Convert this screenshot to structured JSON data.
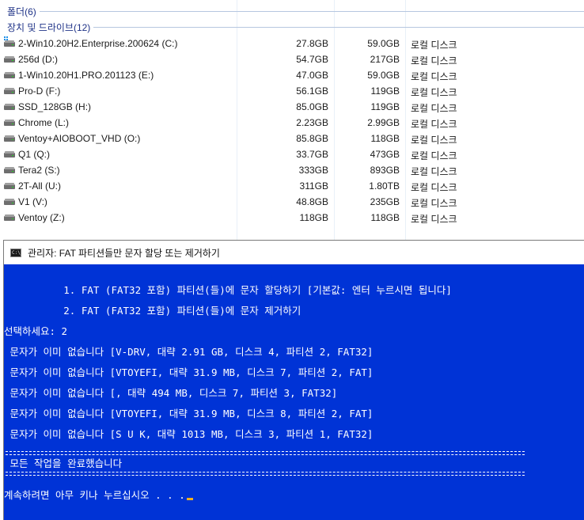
{
  "explorer": {
    "groups": {
      "folders": "폴더(6)",
      "devices": "장치 및 드라이브(12)"
    },
    "drives": [
      {
        "name": "2-Win10.20H2.Enterprise.200624 (C:)",
        "free": "27.8GB",
        "total": "59.0GB",
        "type": "로컬 디스크",
        "icon": "windows-drive-icon"
      },
      {
        "name": "256d (D:)",
        "free": "54.7GB",
        "total": "217GB",
        "type": "로컬 디스크",
        "icon": "drive-icon"
      },
      {
        "name": "1-Win10.20H1.PRO.201123 (E:)",
        "free": "47.0GB",
        "total": "59.0GB",
        "type": "로컬 디스크",
        "icon": "drive-icon"
      },
      {
        "name": "Pro-D (F:)",
        "free": "56.1GB",
        "total": "119GB",
        "type": "로컬 디스크",
        "icon": "drive-icon"
      },
      {
        "name": "SSD_128GB (H:)",
        "free": "85.0GB",
        "total": "119GB",
        "type": "로컬 디스크",
        "icon": "drive-icon"
      },
      {
        "name": "Chrome (L:)",
        "free": "2.23GB",
        "total": "2.99GB",
        "type": "로컬 디스크",
        "icon": "drive-icon"
      },
      {
        "name": "Ventoy+AIOBOOT_VHD (O:)",
        "free": "85.8GB",
        "total": "118GB",
        "type": "로컬 디스크",
        "icon": "drive-icon"
      },
      {
        "name": "Q1 (Q:)",
        "free": "33.7GB",
        "total": "473GB",
        "type": "로컬 디스크",
        "icon": "drive-icon"
      },
      {
        "name": "Tera2 (S:)",
        "free": "333GB",
        "total": "893GB",
        "type": "로컬 디스크",
        "icon": "drive-icon"
      },
      {
        "name": "2T-All (U:)",
        "free": "311GB",
        "total": "1.80TB",
        "type": "로컬 디스크",
        "icon": "drive-icon"
      },
      {
        "name": "V1 (V:)",
        "free": "48.8GB",
        "total": "235GB",
        "type": "로컬 디스크",
        "icon": "drive-icon"
      },
      {
        "name": "Ventoy (Z:)",
        "free": "118GB",
        "total": "118GB",
        "type": "로컬 디스크",
        "icon": "drive-icon"
      }
    ]
  },
  "console": {
    "title": "관리자:  FAT 파티션들만 문자 할당 또는 제거하기",
    "colors": {
      "background": "#0033d6",
      "text": "#ffffff",
      "cursor": "#f0b020"
    },
    "menu": [
      "          1. FAT (FAT32 포함) 파티션(들)에 문자 할당하기 [기본값: 엔터 누르시면 됩니다]",
      "          2. FAT (FAT32 포함) 파티션(들)에 문자 제거하기"
    ],
    "prompt": "선택하세요: 2",
    "results": [
      " 문자가 이미 없습니다 [V-DRV, 대략 2.91 GB, 디스크 4, 파티션 2, FAT32]",
      " 문자가 이미 없습니다 [VTOYEFI, 대략 31.9 MB, 디스크 7, 파티션 2, FAT]",
      " 문자가 이미 없습니다 [, 대략 494 MB, 디스크 7, 파티션 3, FAT32]",
      " 문자가 이미 없습니다 [VTOYEFI, 대략 31.9 MB, 디스크 8, 파티션 2, FAT]",
      " 문자가 이미 없습니다 [S U K, 대략 1013 MB, 디스크 3, 파티션 1, FAT32]"
    ],
    "done": " 모든 작업을 완료했습니다",
    "continue": "계속하려면 아무 키나 누르십시오 . . ."
  }
}
